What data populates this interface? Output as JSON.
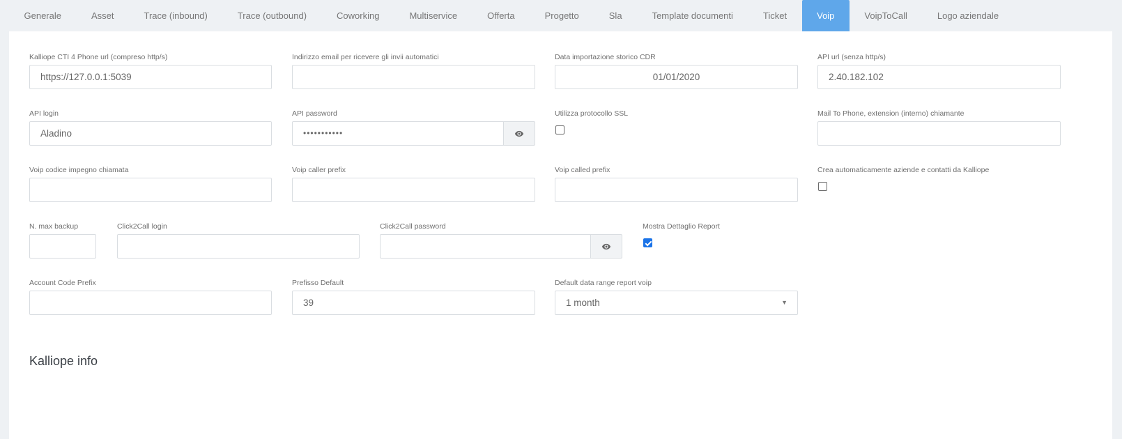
{
  "tabs": [
    {
      "label": "Generale"
    },
    {
      "label": "Asset"
    },
    {
      "label": "Trace (inbound)"
    },
    {
      "label": "Trace (outbound)"
    },
    {
      "label": "Coworking"
    },
    {
      "label": "Multiservice"
    },
    {
      "label": "Offerta"
    },
    {
      "label": "Progetto"
    },
    {
      "label": "Sla"
    },
    {
      "label": "Template documenti"
    },
    {
      "label": "Ticket"
    },
    {
      "label": "Voip",
      "active": true
    },
    {
      "label": "VoipToCall"
    },
    {
      "label": "Logo aziendale"
    }
  ],
  "form": {
    "kalliope_url": {
      "label": "Kalliope CTI 4 Phone url (compreso http/s)",
      "value": "https://127.0.0.1:5039"
    },
    "email_invii": {
      "label": "Indirizzo email per ricevere gli invii automatici",
      "value": ""
    },
    "data_cdr": {
      "label": "Data importazione storico CDR",
      "value": "01/01/2020"
    },
    "api_url": {
      "label": "API url (senza http/s)",
      "value": "2.40.182.102"
    },
    "api_login": {
      "label": "API login",
      "value": "Aladino"
    },
    "api_password": {
      "label": "API password",
      "value": "•••••••••••"
    },
    "ssl": {
      "label": "Utilizza protocollo SSL",
      "checked": false
    },
    "mail_to_phone": {
      "label": "Mail To Phone, extension (interno) chiamante",
      "value": ""
    },
    "codice_impegno": {
      "label": "Voip codice impegno chiamata",
      "value": ""
    },
    "caller_prefix": {
      "label": "Voip caller prefix",
      "value": ""
    },
    "called_prefix": {
      "label": "Voip called prefix",
      "value": ""
    },
    "crea_auto": {
      "label": "Crea automaticamente aziende e contatti da Kalliope",
      "checked": false
    },
    "max_backup": {
      "label": "N. max backup",
      "value": ""
    },
    "c2c_login": {
      "label": "Click2Call login",
      "value": ""
    },
    "c2c_password": {
      "label": "Click2Call password",
      "value": ""
    },
    "dettaglio_report": {
      "label": "Mostra Dettaglio Report",
      "checked": true
    },
    "account_code_prefix": {
      "label": "Account Code Prefix",
      "value": ""
    },
    "prefisso_default": {
      "label": "Prefisso Default",
      "value": "39"
    },
    "data_range": {
      "label": "Default data range report voip",
      "value": "1 month"
    }
  },
  "section": {
    "title": "Kalliope info"
  },
  "colors": {
    "accent": "#5fa7ea",
    "checkbox": "#1a73e8"
  },
  "icons": {
    "reveal": "eye-icon",
    "dropdown": "caret-down-icon"
  }
}
